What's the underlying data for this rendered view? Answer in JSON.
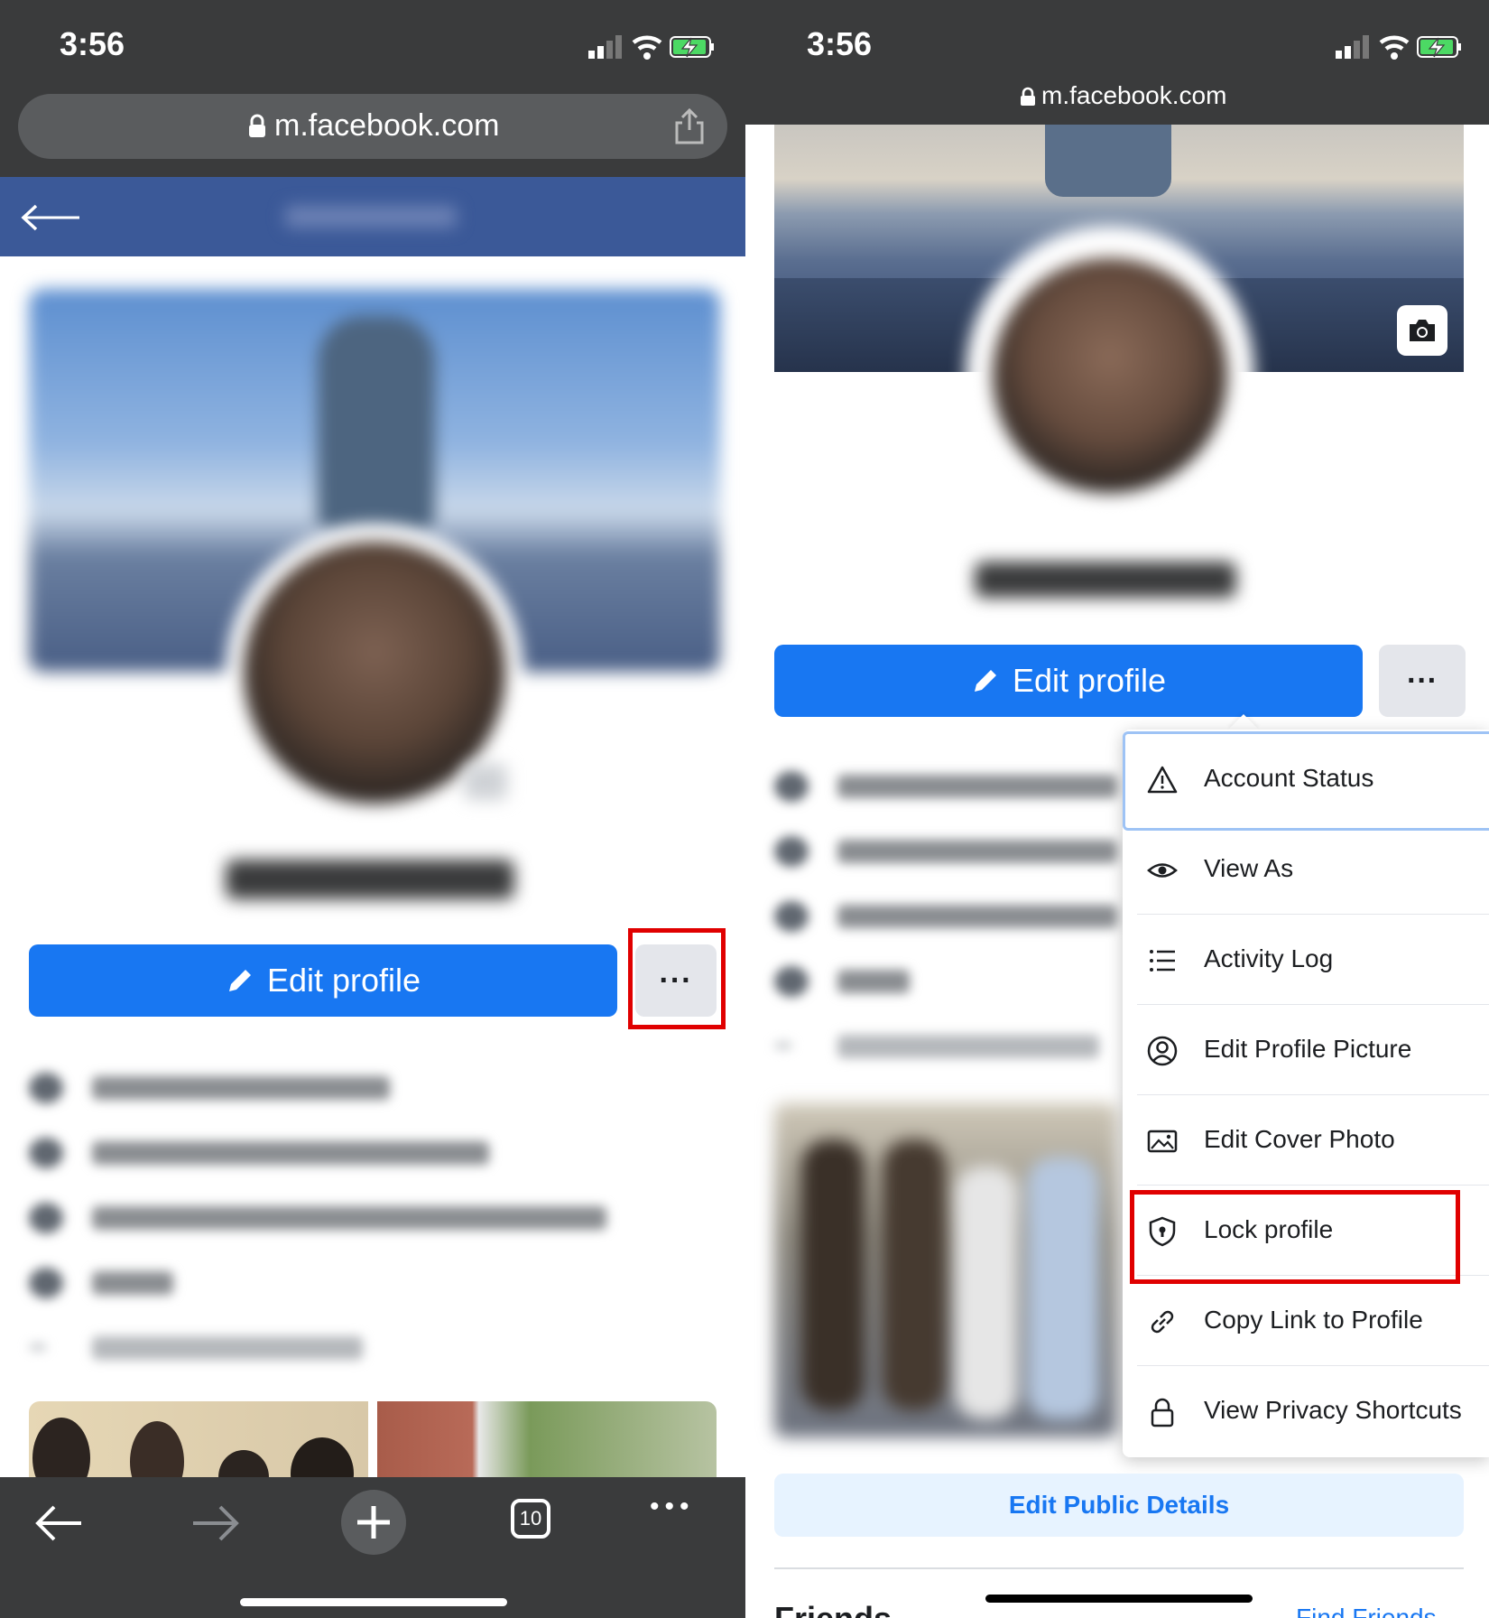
{
  "left": {
    "status": {
      "time": "3:56"
    },
    "browser": {
      "url": "m.facebook.com"
    },
    "profile": {
      "edit_profile_label": "Edit profile",
      "more_label": "···"
    },
    "toolbar": {
      "tabs_count": "10",
      "more_label": "•••"
    }
  },
  "right": {
    "status": {
      "time": "3:56"
    },
    "browser": {
      "url": "m.facebook.com"
    },
    "profile": {
      "edit_profile_label": "Edit profile",
      "more_label": "···"
    },
    "menu": {
      "items": [
        {
          "label": "Account Status",
          "icon": "warning-icon"
        },
        {
          "label": "View As",
          "icon": "eye-icon"
        },
        {
          "label": "Activity Log",
          "icon": "list-icon"
        },
        {
          "label": "Edit Profile Picture",
          "icon": "profile-circle-icon"
        },
        {
          "label": "Edit Cover Photo",
          "icon": "image-icon"
        },
        {
          "label": "Lock profile",
          "icon": "shield-lock-icon"
        },
        {
          "label": "Copy Link to Profile",
          "icon": "link-icon"
        },
        {
          "label": "View Privacy Shortcuts",
          "icon": "lock-icon"
        }
      ]
    },
    "edit_public_details_label": "Edit Public Details",
    "friends_heading": "Friends",
    "find_friends_label": "Find Friends"
  },
  "colors": {
    "facebook_blue": "#1877f2",
    "header_blue": "#3b5998",
    "status_bar": "#3a3b3c",
    "highlight_red": "#e00000"
  }
}
